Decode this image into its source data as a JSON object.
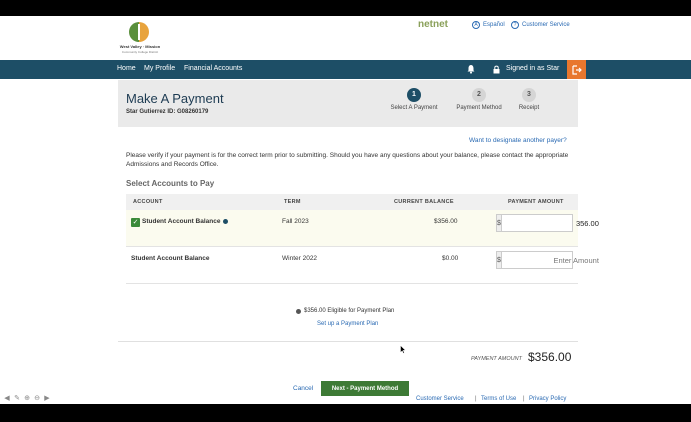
{
  "header": {
    "logo_text": "West Valley · Mission",
    "logo_subtext": "Community College District",
    "partner_logo": "netnet",
    "utility_links": [
      {
        "label": "Español",
        "icon": "language-icon"
      },
      {
        "label": "Customer Service",
        "icon": "help-icon"
      }
    ]
  },
  "nav": {
    "items": [
      "Home",
      "My Profile",
      "Financial Accounts"
    ],
    "signed_in": "Signed in as Star",
    "icons": [
      "bell-icon",
      "lock-icon",
      "sign-out-icon"
    ]
  },
  "page": {
    "title": "Make A Payment",
    "student_id": "Star Gutierrez ID: G08260179"
  },
  "steps": [
    {
      "number": "1",
      "label": "Select A Payment",
      "active": true
    },
    {
      "number": "2",
      "label": "Payment Method",
      "active": false
    },
    {
      "number": "3",
      "label": "Receipt",
      "active": false
    }
  ],
  "designate_link": "Want to designate another payer?",
  "instructions": "Please verify if your payment is for the correct term prior to submitting.  Should you have any questions about your balance, please contact the appropriate Admissions and Records Office.",
  "section_heading": "Select Accounts to Pay",
  "table": {
    "columns": [
      "ACCOUNT",
      "TERM",
      "CURRENT BALANCE",
      "PAYMENT AMOUNT"
    ],
    "currency_symbol": "$",
    "rows": [
      {
        "account": "Student Account Balance",
        "term": "Fall 2023",
        "balance": "$356.00",
        "payment": "356.00",
        "placeholder": "",
        "checked": true,
        "has_info": true
      },
      {
        "account": "Student Account Balance",
        "term": "Winter 2022",
        "balance": "$0.00",
        "payment": "",
        "placeholder": "Enter Amount",
        "checked": false,
        "has_info": false
      }
    ]
  },
  "plan": {
    "eligible_text": "$356.00 Eligible for Payment Plan",
    "setup_link": "Set up a Payment Plan"
  },
  "total": {
    "label": "PAYMENT AMOUNT",
    "value": "$356.00"
  },
  "actions": {
    "cancel": "Cancel",
    "next": "Next - Payment Method"
  },
  "footer": {
    "links": [
      "Customer Service",
      "Terms of Use",
      "Privacy Policy"
    ],
    "separator": "|"
  },
  "colors": {
    "navbar": "#1d4e66",
    "accent_orange": "#e8772e",
    "primary_button": "#3d7a35",
    "link": "#2a6ab3"
  }
}
